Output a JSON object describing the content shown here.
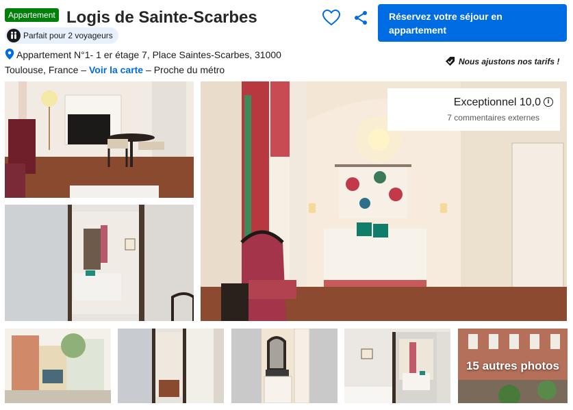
{
  "listing": {
    "type_badge": "Appartement",
    "title": "Logis de Sainte-Scarbes",
    "guests": "Parfait pour 2 voyageurs",
    "address": "Appartement N°1- 1 er étage 7, Place Saintes-Scarbes, 31000 Toulouse, France",
    "address_sep1": " – ",
    "map_link": "Voir la carte",
    "address_sep2": " – ",
    "proximity": "Proche du métro"
  },
  "actions": {
    "book_label": "Réservez votre séjour en appartement",
    "price_match": "Nous ajustons nos tarifs !"
  },
  "rating": {
    "label": "Exceptionnel 10,0",
    "reviews": "7 commentaires externes"
  },
  "gallery": {
    "more_photos": "15 autres photos"
  },
  "colors": {
    "brand_blue": "#006ce4",
    "badge_green": "#008009"
  }
}
